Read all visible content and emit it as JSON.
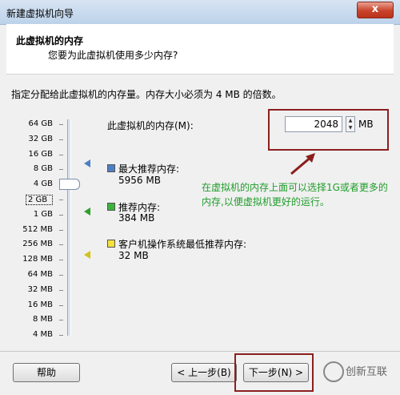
{
  "window": {
    "title": "新建虚拟机向导",
    "close_label": "x"
  },
  "header": {
    "title": "此虚拟机的内存",
    "subtitle": "您要为此虚拟机使用多少内存?"
  },
  "instruction": "指定分配给此虚拟机的内存量。内存大小必须为 4 MB 的倍数。",
  "scale": {
    "labels": [
      "64 GB",
      "32 GB",
      "16 GB",
      "8 GB",
      "4 GB",
      "2 GB",
      "1 GB",
      "512 MB",
      "256 MB",
      "128 MB",
      "64 MB",
      "32 MB",
      "16 MB",
      "8 MB",
      "4 MB"
    ],
    "selected": "2 GB"
  },
  "memory": {
    "label": "此虚拟机的内存(M):",
    "value": "2048",
    "unit": "MB"
  },
  "legend": [
    {
      "title": "最大推荐内存:",
      "value": "5956 MB",
      "color": "#4f7fc3",
      "marker_color": "#4f7fc3"
    },
    {
      "title": "推荐内存:",
      "value": "384 MB",
      "color": "#3db33d",
      "marker_color": "#2f9f2f"
    },
    {
      "title": "客户机操作系统最低推荐内存:",
      "value": "32 MB",
      "color": "#f5e040",
      "marker_color": "#d4c21a"
    }
  ],
  "annotation": "在虚拟机的内存上面可以选择1G或者更多的内存,以便虚拟机更好的运行。",
  "footer": {
    "help": "帮助",
    "back": "< 上一步(B)",
    "next": "下一步(N) >"
  },
  "watermark": "创新互联"
}
